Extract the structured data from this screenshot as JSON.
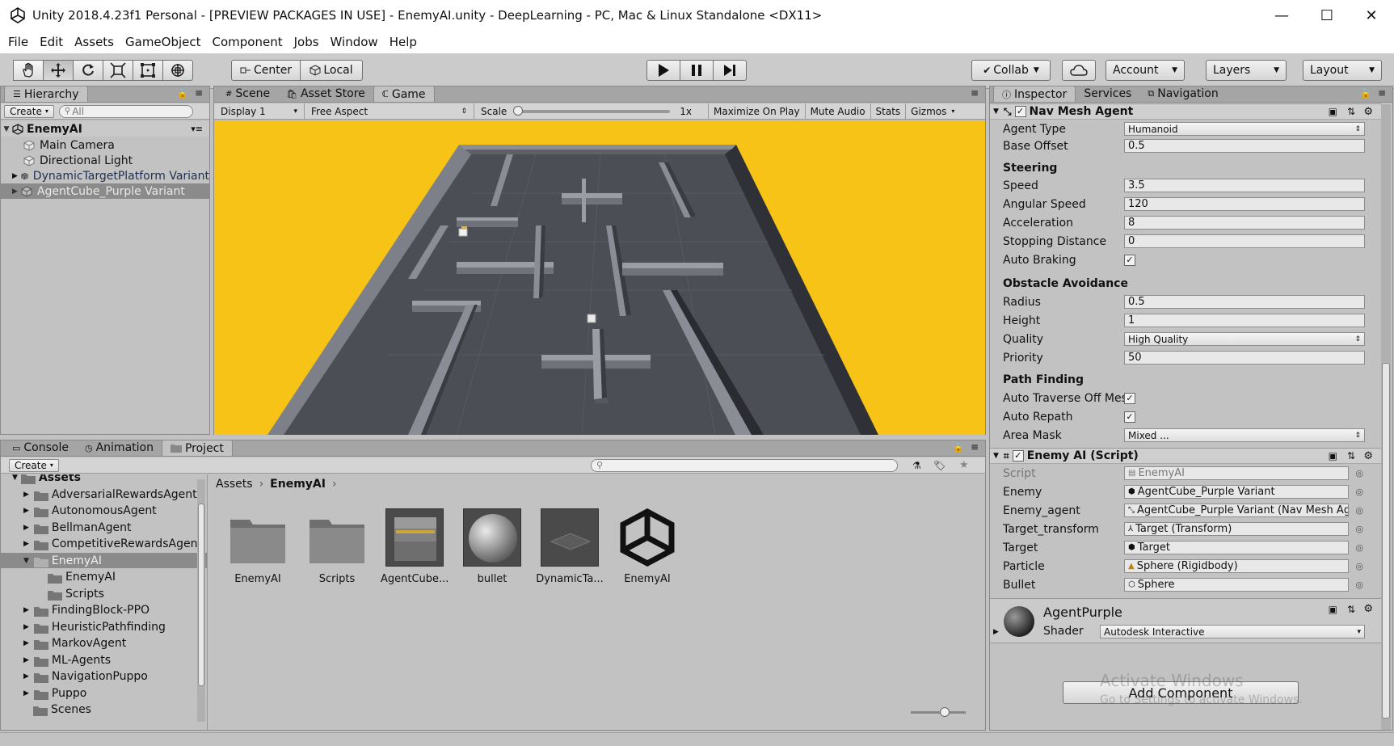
{
  "window": {
    "title": "Unity 2018.4.23f1 Personal - [PREVIEW PACKAGES IN USE] - EnemyAI.unity - DeepLearning - PC, Mac & Linux Standalone <DX11>",
    "minimize": "—",
    "maximize": "☐",
    "close": "✕"
  },
  "menu": [
    "File",
    "Edit",
    "Assets",
    "GameObject",
    "Component",
    "Jobs",
    "Window",
    "Help"
  ],
  "toolbar": {
    "pivot": "Center",
    "space": "Local",
    "collab": "Collab",
    "account": "Account",
    "layers": "Layers",
    "layout": "Layout"
  },
  "hierarchy": {
    "tab": "Hierarchy",
    "create": "Create",
    "search_placeholder": "All",
    "scene": "EnemyAI",
    "items": [
      {
        "label": "Main Camera"
      },
      {
        "label": "Directional Light"
      },
      {
        "label": "DynamicTargetPlatform Variant"
      },
      {
        "label": "AgentCube_Purple Variant"
      }
    ]
  },
  "center": {
    "tabs": [
      "Scene",
      "Asset Store",
      "Game"
    ],
    "display": "Display 1",
    "aspect": "Free Aspect",
    "scale_label": "Scale",
    "scale_value": "1x",
    "maximize": "Maximize On Play",
    "mute": "Mute Audio",
    "stats": "Stats",
    "gizmos": "Gizmos",
    "background_color": "#f7c316"
  },
  "bottom": {
    "tabs": [
      "Console",
      "Animation",
      "Project"
    ],
    "create": "Create",
    "breadcrumb": [
      "Assets",
      "EnemyAI"
    ],
    "tree_root": "Assets",
    "tree": [
      {
        "label": "AdversarialRewardsAgent",
        "depth": 1,
        "expand": true
      },
      {
        "label": "AutonomousAgent",
        "depth": 1,
        "expand": true
      },
      {
        "label": "BellmanAgent",
        "depth": 1,
        "expand": true
      },
      {
        "label": "CompetitiveRewardsAgent",
        "depth": 1,
        "expand": true
      },
      {
        "label": "EnemyAI",
        "depth": 1,
        "expand": true,
        "selected": true
      },
      {
        "label": "EnemyAI",
        "depth": 2,
        "expand": false
      },
      {
        "label": "Scripts",
        "depth": 2,
        "expand": false
      },
      {
        "label": "FindingBlock-PPO",
        "depth": 1,
        "expand": true
      },
      {
        "label": "HeuristicPathfinding",
        "depth": 1,
        "expand": true
      },
      {
        "label": "MarkovAgent",
        "depth": 1,
        "expand": true
      },
      {
        "label": "ML-Agents",
        "depth": 1,
        "expand": true
      },
      {
        "label": "NavigationPuppo",
        "depth": 1,
        "expand": true
      },
      {
        "label": "Puppo",
        "depth": 1,
        "expand": true
      },
      {
        "label": "Scenes",
        "depth": 1,
        "expand": false
      }
    ],
    "assets": [
      "EnemyAI",
      "Scripts",
      "AgentCube...",
      "bullet",
      "DynamicTa...",
      "EnemyAI"
    ]
  },
  "inspector": {
    "tabs": [
      "Inspector",
      "Services",
      "Navigation"
    ],
    "navmesh": {
      "title": "Nav Mesh Agent",
      "agent_type_label": "Agent Type",
      "agent_type": "Humanoid",
      "base_offset_label": "Base Offset",
      "base_offset": "0.5",
      "steering": "Steering",
      "speed_label": "Speed",
      "speed": "3.5",
      "angular_label": "Angular Speed",
      "angular": "120",
      "accel_label": "Acceleration",
      "accel": "8",
      "stop_label": "Stopping Distance",
      "stop": "0",
      "braking_label": "Auto Braking",
      "braking": "✓",
      "avoid": "Obstacle Avoidance",
      "radius_label": "Radius",
      "radius": "0.5",
      "height_label": "Height",
      "height": "1",
      "quality_label": "Quality",
      "quality": "High Quality",
      "priority_label": "Priority",
      "priority": "50",
      "pathfinding": "Path Finding",
      "traverse_label": "Auto Traverse Off Mesh Link",
      "traverse": "✓",
      "repath_label": "Auto Repath",
      "repath": "✓",
      "areamask_label": "Area Mask",
      "areamask": "Mixed ..."
    },
    "enemy": {
      "title": "Enemy AI (Script)",
      "script_label": "Script",
      "script": "EnemyAI",
      "enemy_label": "Enemy",
      "enemy": "AgentCube_Purple Variant",
      "enemy_agent_label": "Enemy_agent",
      "enemy_agent": "AgentCube_Purple Variant (Nav Mesh Agent)",
      "target_transform_label": "Target_transform",
      "target_transform": "Target (Transform)",
      "target_label": "Target",
      "target": "Target",
      "particle_label": "Particle",
      "particle": "Sphere (Rigidbody)",
      "bullet_label": "Bullet",
      "bullet": "Sphere"
    },
    "material": {
      "name": "AgentPurple",
      "shader_label": "Shader",
      "shader": "Autodesk Interactive"
    },
    "add_component": "Add Component",
    "watermark1": "Activate Windows",
    "watermark2": "Go to Settings to activate Windows."
  }
}
